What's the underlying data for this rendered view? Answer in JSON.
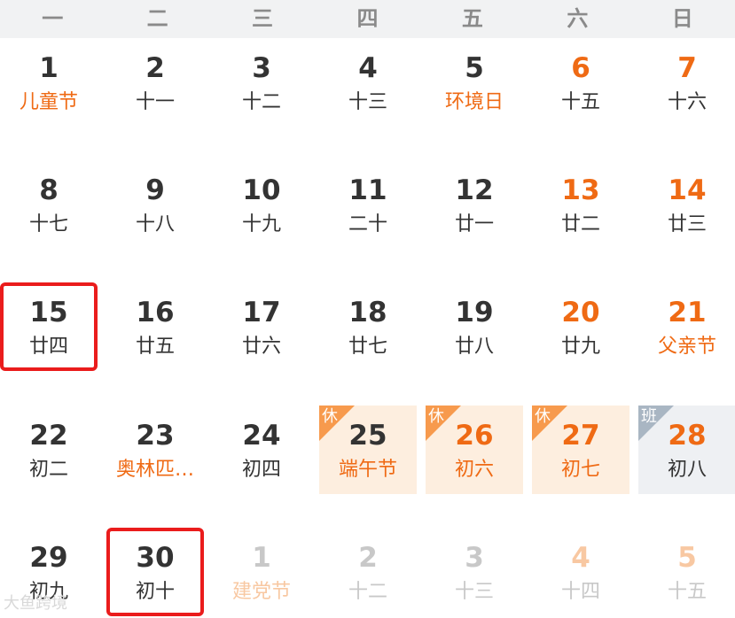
{
  "weekdays": [
    "一",
    "二",
    "三",
    "四",
    "五",
    "六",
    "日"
  ],
  "weeks": [
    [
      {
        "day": "1",
        "sub": "儿童节",
        "festival": true
      },
      {
        "day": "2",
        "sub": "十一"
      },
      {
        "day": "3",
        "sub": "十二"
      },
      {
        "day": "4",
        "sub": "十三"
      },
      {
        "day": "5",
        "sub": "环境日",
        "festival": true
      },
      {
        "day": "6",
        "sub": "十五",
        "weekend": true
      },
      {
        "day": "7",
        "sub": "十六",
        "weekend": true
      }
    ],
    [
      {
        "day": "8",
        "sub": "十七"
      },
      {
        "day": "9",
        "sub": "十八"
      },
      {
        "day": "10",
        "sub": "十九"
      },
      {
        "day": "11",
        "sub": "二十"
      },
      {
        "day": "12",
        "sub": "廿一"
      },
      {
        "day": "13",
        "sub": "廿二",
        "weekend": true
      },
      {
        "day": "14",
        "sub": "廿三",
        "weekend": true
      }
    ],
    [
      {
        "day": "15",
        "sub": "廿四",
        "selected": true
      },
      {
        "day": "16",
        "sub": "廿五"
      },
      {
        "day": "17",
        "sub": "廿六"
      },
      {
        "day": "18",
        "sub": "廿七"
      },
      {
        "day": "19",
        "sub": "廿八"
      },
      {
        "day": "20",
        "sub": "廿九",
        "weekend": true
      },
      {
        "day": "21",
        "sub": "父亲节",
        "weekend": true,
        "festival": true
      }
    ],
    [
      {
        "day": "22",
        "sub": "初二"
      },
      {
        "day": "23",
        "sub": "奥林匹…",
        "festival": true
      },
      {
        "day": "24",
        "sub": "初四"
      },
      {
        "day": "25",
        "sub": "端午节",
        "festival": true,
        "status": "rest",
        "badge": "休"
      },
      {
        "day": "26",
        "sub": "初六",
        "weekend": true,
        "festival": true,
        "status": "rest",
        "badge": "休"
      },
      {
        "day": "27",
        "sub": "初七",
        "weekend": true,
        "festival": true,
        "status": "rest",
        "badge": "休"
      },
      {
        "day": "28",
        "sub": "初八",
        "weekend": true,
        "status": "work",
        "badge": "班"
      }
    ],
    [
      {
        "day": "29",
        "sub": "初九"
      },
      {
        "day": "30",
        "sub": "初十",
        "selected": true
      },
      {
        "day": "1",
        "sub": "建党节",
        "other": true,
        "festival": true
      },
      {
        "day": "2",
        "sub": "十二",
        "other": true
      },
      {
        "day": "3",
        "sub": "十三",
        "other": true
      },
      {
        "day": "4",
        "sub": "十四",
        "other": true,
        "weekend": true
      },
      {
        "day": "5",
        "sub": "十五",
        "other": true,
        "weekend": true
      }
    ]
  ],
  "watermark": "大鱼跨境",
  "colors": {
    "accent": "#ef6a14",
    "selected_border": "#ea1c1c",
    "rest_bg": "#fdeedf",
    "work_bg": "#eef0f3"
  }
}
